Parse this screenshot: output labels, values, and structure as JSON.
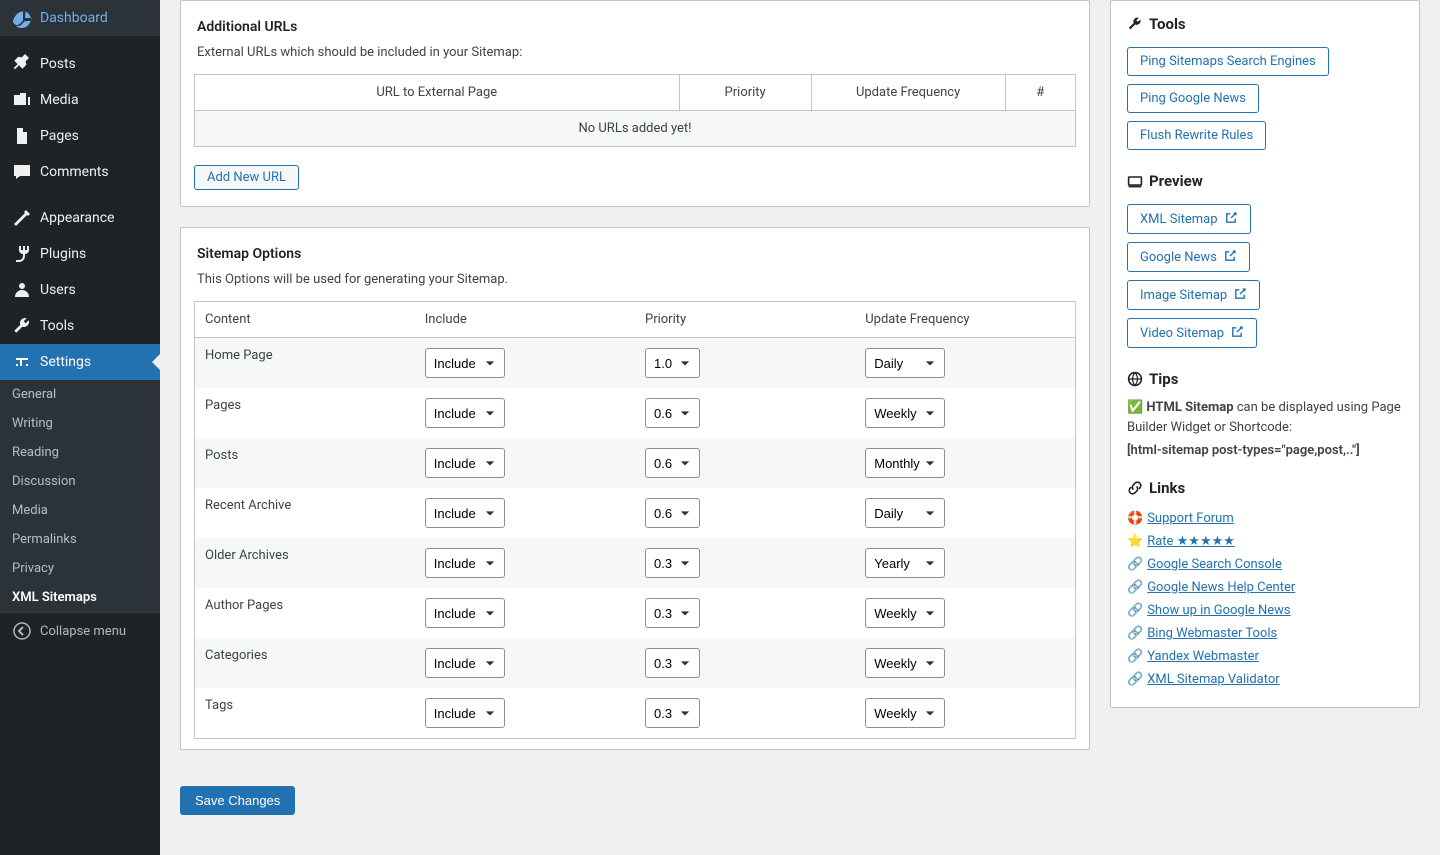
{
  "sidebar": {
    "items": [
      {
        "label": "Dashboard",
        "icon": "dashboard"
      },
      {
        "label": "Posts",
        "icon": "pin"
      },
      {
        "label": "Media",
        "icon": "media"
      },
      {
        "label": "Pages",
        "icon": "pages"
      },
      {
        "label": "Comments",
        "icon": "comments"
      },
      {
        "label": "Appearance",
        "icon": "appearance"
      },
      {
        "label": "Plugins",
        "icon": "plugins"
      },
      {
        "label": "Users",
        "icon": "users"
      },
      {
        "label": "Tools",
        "icon": "tools"
      },
      {
        "label": "Settings",
        "icon": "settings"
      }
    ],
    "submenu": [
      "General",
      "Writing",
      "Reading",
      "Discussion",
      "Media",
      "Permalinks",
      "Privacy",
      "XML Sitemaps"
    ],
    "collapse": "Collapse menu"
  },
  "box1": {
    "title": "Additional URLs",
    "desc": "External URLs which should be included in your Sitemap:",
    "cols": [
      "URL to External Page",
      "Priority",
      "Update Frequency",
      "#"
    ],
    "empty": "No URLs added yet!",
    "add": "Add New URL"
  },
  "box2": {
    "title": "Sitemap Options",
    "desc": "This Options will be used for generating your Sitemap.",
    "cols": [
      "Content",
      "Include",
      "Priority",
      "Update Frequency"
    ],
    "rows": [
      {
        "content": "Home Page",
        "include": "Include",
        "priority": "1.0",
        "freq": "Daily"
      },
      {
        "content": "Pages",
        "include": "Include",
        "priority": "0.6",
        "freq": "Weekly"
      },
      {
        "content": "Posts",
        "include": "Include",
        "priority": "0.6",
        "freq": "Monthly"
      },
      {
        "content": "Recent Archive",
        "include": "Include",
        "priority": "0.6",
        "freq": "Daily"
      },
      {
        "content": "Older Archives",
        "include": "Include",
        "priority": "0.3",
        "freq": "Yearly"
      },
      {
        "content": "Author Pages",
        "include": "Include",
        "priority": "0.3",
        "freq": "Weekly"
      },
      {
        "content": "Categories",
        "include": "Include",
        "priority": "0.3",
        "freq": "Weekly"
      },
      {
        "content": "Tags",
        "include": "Include",
        "priority": "0.3",
        "freq": "Weekly"
      }
    ]
  },
  "save": "Save Changes",
  "right": {
    "tools_h": "Tools",
    "tools": [
      "Ping Sitemaps Search Engines",
      "Ping Google News",
      "Flush Rewrite Rules"
    ],
    "preview_h": "Preview",
    "preview": [
      "XML Sitemap",
      "Google News",
      "Image Sitemap",
      "Video Sitemap"
    ],
    "tips_h": "Tips",
    "tips_prefix": "✅ ",
    "tips_bold": "HTML Sitemap",
    "tips_rest": " can be displayed using Page Builder Widget or Shortcode:",
    "tips_code": "[html-sitemap post-types=\"page,post,..\"]",
    "links_h": "Links",
    "links": [
      {
        "icon": "🛟",
        "label": "Support Forum"
      },
      {
        "icon": "⭐",
        "label": "Rate ★★★★★"
      },
      {
        "icon": "🔗",
        "label": "Google Search Console"
      },
      {
        "icon": "🔗",
        "label": "Google News Help Center"
      },
      {
        "icon": "🔗",
        "label": "Show up in Google News"
      },
      {
        "icon": "🔗",
        "label": "Bing Webmaster Tools"
      },
      {
        "icon": "🔗",
        "label": "Yandex Webmaster"
      },
      {
        "icon": "🔗",
        "label": "XML Sitemap Validator"
      }
    ]
  }
}
